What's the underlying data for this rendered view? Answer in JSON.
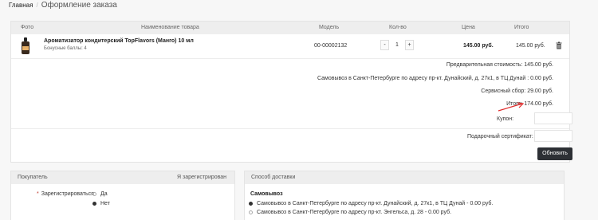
{
  "breadcrumb": {
    "home": "Главная",
    "separator": "/",
    "current": "Оформление заказа"
  },
  "cart": {
    "columns": [
      "Фото",
      "Наименование товара",
      "Модель",
      "Кол-во",
      "Цена",
      "Итого"
    ],
    "item": {
      "name": "Ароматизатор кондитерский TopFlavors (Манго) 10 мл",
      "bonus": "Бонусные баллы: 4",
      "model": "00-00002132",
      "qty_minus": "-",
      "qty": "1",
      "qty_plus": "+",
      "price": "145.00 руб.",
      "total": "145.00 руб."
    },
    "summary": {
      "prelim": "Предварительная стоимость: 145.00 руб.",
      "pickup": "Самовывоз в Санкт-Петербурге по адресу пр-кт. Дунайский, д. 27к1, в ТЦ Дунай : 0.00 руб.",
      "service": "Сервисный сбор: 29.00 руб.",
      "total": "Итого: 174.00 руб."
    },
    "coupon_label": "Купон:",
    "certificate_label": "Подарочный сертификат:",
    "update_button": "Обновить"
  },
  "buyer": {
    "title": "Покупатель",
    "registered_link": "Я зарегистрирован",
    "field_label": "Зарегистрироваться",
    "options": [
      "Да",
      "Нет"
    ],
    "selected": "Нет"
  },
  "delivery": {
    "title": "Способ доставки",
    "group": "Самовывоз",
    "options": [
      "Самовывоз в Санкт-Петербурге по адресу пр-кт. Дунайский, д. 27к1, в ТЦ Дунай - 0.00 руб.",
      "Самовывоз в Санкт-Петербурге по адресу пр-кт. Энгельса, д. 28 - 0.00 руб."
    ]
  },
  "colors": {
    "accent": "#2d3035",
    "arrow": "#e02a2a",
    "header_bg": "#eeeeee"
  }
}
